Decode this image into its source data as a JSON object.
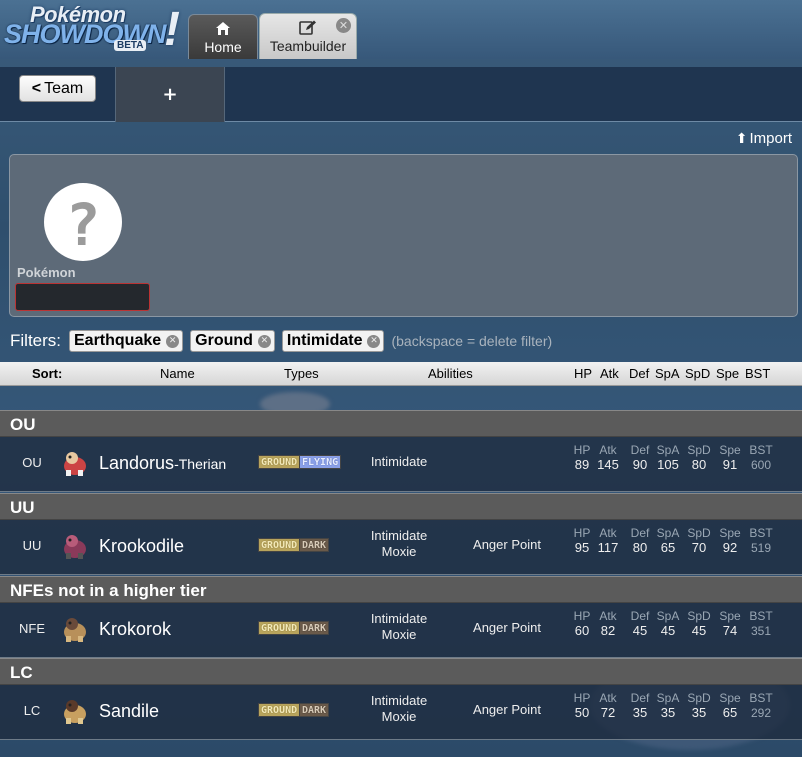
{
  "logo": {
    "line1": "Pokémon",
    "line2": "SHOWDOWN",
    "badge": "BETA",
    "mark": "!"
  },
  "tabs": [
    {
      "label": "Home",
      "icon": "home-icon"
    },
    {
      "label": "Teambuilder",
      "icon": "edit-icon",
      "close": "⊗"
    }
  ],
  "teambar": {
    "back_label": "Team",
    "add_label": "+"
  },
  "import": {
    "label": "Import"
  },
  "panel": {
    "pokemon_label": "Pokémon",
    "pokemon_value": ""
  },
  "filters": {
    "label": "Filters:",
    "chips": [
      "Earthquake",
      "Ground",
      "Intimidate"
    ],
    "hint": "(backspace = delete filter)"
  },
  "sort": {
    "label": "Sort:",
    "name": "Name",
    "types": "Types",
    "abilities": "Abilities",
    "stats": [
      "HP",
      "Atk",
      "Def",
      "SpA",
      "SpD",
      "Spe",
      "BST"
    ]
  },
  "groups": [
    {
      "title": "OU",
      "rows": [
        {
          "tier": "OU",
          "name": "Landorus",
          "forme": "-Therian",
          "types": [
            "GROUND",
            "FLYING"
          ],
          "abilities": [
            "Intimidate"
          ],
          "hidden": "",
          "stats": [
            "89",
            "145",
            "90",
            "105",
            "80",
            "91",
            "600"
          ]
        }
      ]
    },
    {
      "title": "UU",
      "rows": [
        {
          "tier": "UU",
          "name": "Krookodile",
          "forme": "",
          "types": [
            "GROUND",
            "DARK"
          ],
          "abilities": [
            "Intimidate",
            "Moxie"
          ],
          "hidden": "Anger Point",
          "stats": [
            "95",
            "117",
            "80",
            "65",
            "70",
            "92",
            "519"
          ]
        }
      ]
    },
    {
      "title": "NFEs not in a higher tier",
      "rows": [
        {
          "tier": "NFE",
          "name": "Krokorok",
          "forme": "",
          "types": [
            "GROUND",
            "DARK"
          ],
          "abilities": [
            "Intimidate",
            "Moxie"
          ],
          "hidden": "Anger Point",
          "stats": [
            "60",
            "82",
            "45",
            "45",
            "45",
            "74",
            "351"
          ]
        }
      ]
    },
    {
      "title": "LC",
      "rows": [
        {
          "tier": "LC",
          "name": "Sandile",
          "forme": "",
          "types": [
            "GROUND",
            "DARK"
          ],
          "abilities": [
            "Intimidate",
            "Moxie"
          ],
          "hidden": "Anger Point",
          "stats": [
            "50",
            "72",
            "35",
            "35",
            "35",
            "65",
            "292"
          ]
        }
      ]
    }
  ],
  "colors": {
    "ground": "#b8a45c",
    "flying": "#8aa0e8",
    "dark": "#6a5a4a",
    "accent": "#7fb2ea"
  }
}
